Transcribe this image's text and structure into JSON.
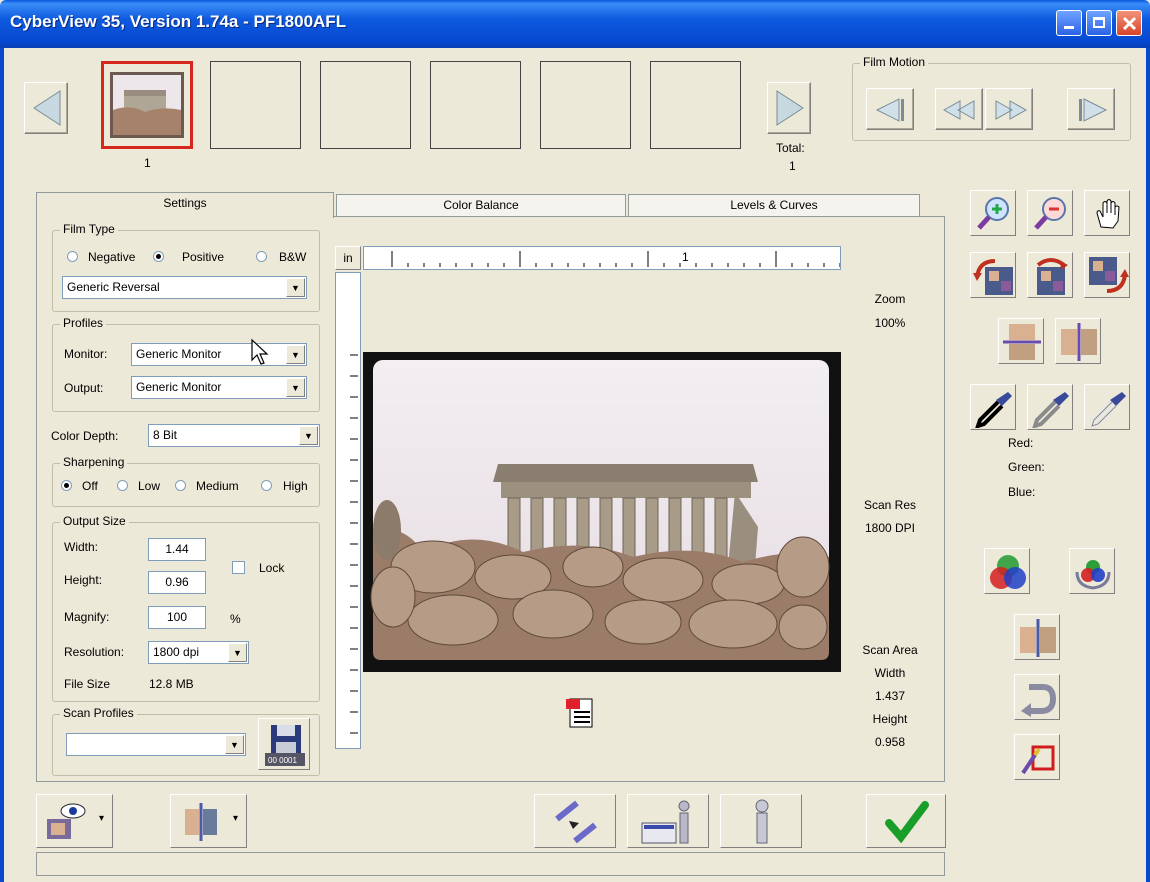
{
  "window": {
    "title": "CyberView 35, Version 1.74a - PF1800AFL"
  },
  "filmstrip": {
    "frame1_number": "1",
    "total_label": "Total:",
    "total_value": "1"
  },
  "film_motion": {
    "legend": "Film Motion"
  },
  "tabs": {
    "settings": "Settings",
    "color_balance": "Color Balance",
    "levels_curves": "Levels & Curves"
  },
  "film_type": {
    "legend": "Film Type",
    "options": [
      "Negative",
      "Positive",
      "B&W"
    ],
    "selected": "Positive",
    "preset": "Generic Reversal"
  },
  "profiles": {
    "legend": "Profiles",
    "monitor_label": "Monitor:",
    "monitor_value": "Generic Monitor",
    "output_label": "Output:",
    "output_value": "Generic Monitor"
  },
  "color_depth": {
    "label": "Color Depth:",
    "value": "8 Bit"
  },
  "sharpening": {
    "legend": "Sharpening",
    "options": [
      "Off",
      "Low",
      "Medium",
      "High"
    ],
    "selected": "Off"
  },
  "output_size": {
    "legend": "Output Size",
    "width_label": "Width:",
    "width_value": "1.44",
    "height_label": "Height:",
    "height_value": "0.96",
    "lock_label": "Lock",
    "magnify_label": "Magnify:",
    "magnify_value": "100",
    "magnify_unit": "%",
    "resolution_label": "Resolution:",
    "resolution_value": "1800 dpi",
    "filesize_label": "File Size",
    "filesize_value": "12.8 MB"
  },
  "scan_profiles": {
    "legend": "Scan Profiles",
    "value": ""
  },
  "ruler": {
    "unit": "in",
    "mark": "1"
  },
  "zoom": {
    "label": "Zoom",
    "value": "100%"
  },
  "scan_res": {
    "label": "Scan Res",
    "value": "1800 DPI"
  },
  "scan_area": {
    "label": "Scan Area",
    "width_label": "Width",
    "width_value": "1.437",
    "height_label": "Height",
    "height_value": "0.958"
  },
  "color_readout": {
    "red": "Red:",
    "green": "Green:",
    "blue": "Blue:"
  },
  "icons": [
    "arrow-left-icon",
    "arrow-right-icon",
    "zoom-in-icon",
    "zoom-out-icon",
    "hand-pan-icon",
    "rotate-left-icon",
    "rotate-180-icon",
    "rotate-right-icon",
    "flip-vertical-icon",
    "flip-horizontal-icon",
    "eyedropper-black-icon",
    "eyedropper-gray-icon",
    "eyedropper-white-icon",
    "color-wheel-icon",
    "auto-color-icon",
    "mirror-icon",
    "undo-icon",
    "crop-icon",
    "save-icon",
    "preview-icon",
    "batch-icon",
    "scan-icon",
    "info-icon",
    "about-icon",
    "ok-check-icon",
    "document-icon"
  ],
  "colors": {
    "title_bar": "#0A58E0",
    "window_bg": "#ECE9D8",
    "selected_frame": "#D6271C",
    "check": "#1A9E2A"
  }
}
